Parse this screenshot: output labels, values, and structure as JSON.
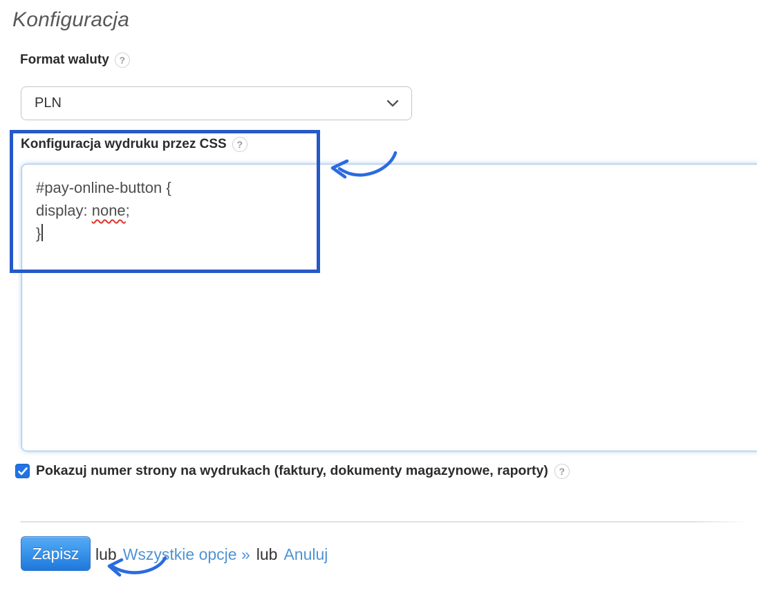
{
  "ui": {
    "help_glyph": "?"
  },
  "page": {
    "title": "Konfiguracja"
  },
  "currency": {
    "label": "Format waluty",
    "value": "PLN"
  },
  "css_print": {
    "label": "Konfiguracja wydruku przez CSS",
    "code": {
      "line1": "#pay-online-button {",
      "line2_prefix": "display: ",
      "line2_word": "none",
      "line2_suffix": ";",
      "line3": "}"
    }
  },
  "page_numbers": {
    "label": "Pokazuj numer strony na wydrukach (faktury, dokumenty magazynowe, raporty)",
    "checked": true
  },
  "actions": {
    "save_label": "Zapisz",
    "or_1": "lub",
    "all_options_label": "Wszystkie opcje »",
    "or_2": "lub",
    "cancel_label": "Anuluj"
  },
  "colors": {
    "annotation_blue": "#2459c8",
    "arrow_blue": "#2b6be0",
    "checkbox_blue": "#2273e3",
    "link_blue": "#5093d4",
    "button_gradient_top": "#58aaf3",
    "button_gradient_bottom": "#2078da",
    "spellcheck_red": "#e03328"
  }
}
